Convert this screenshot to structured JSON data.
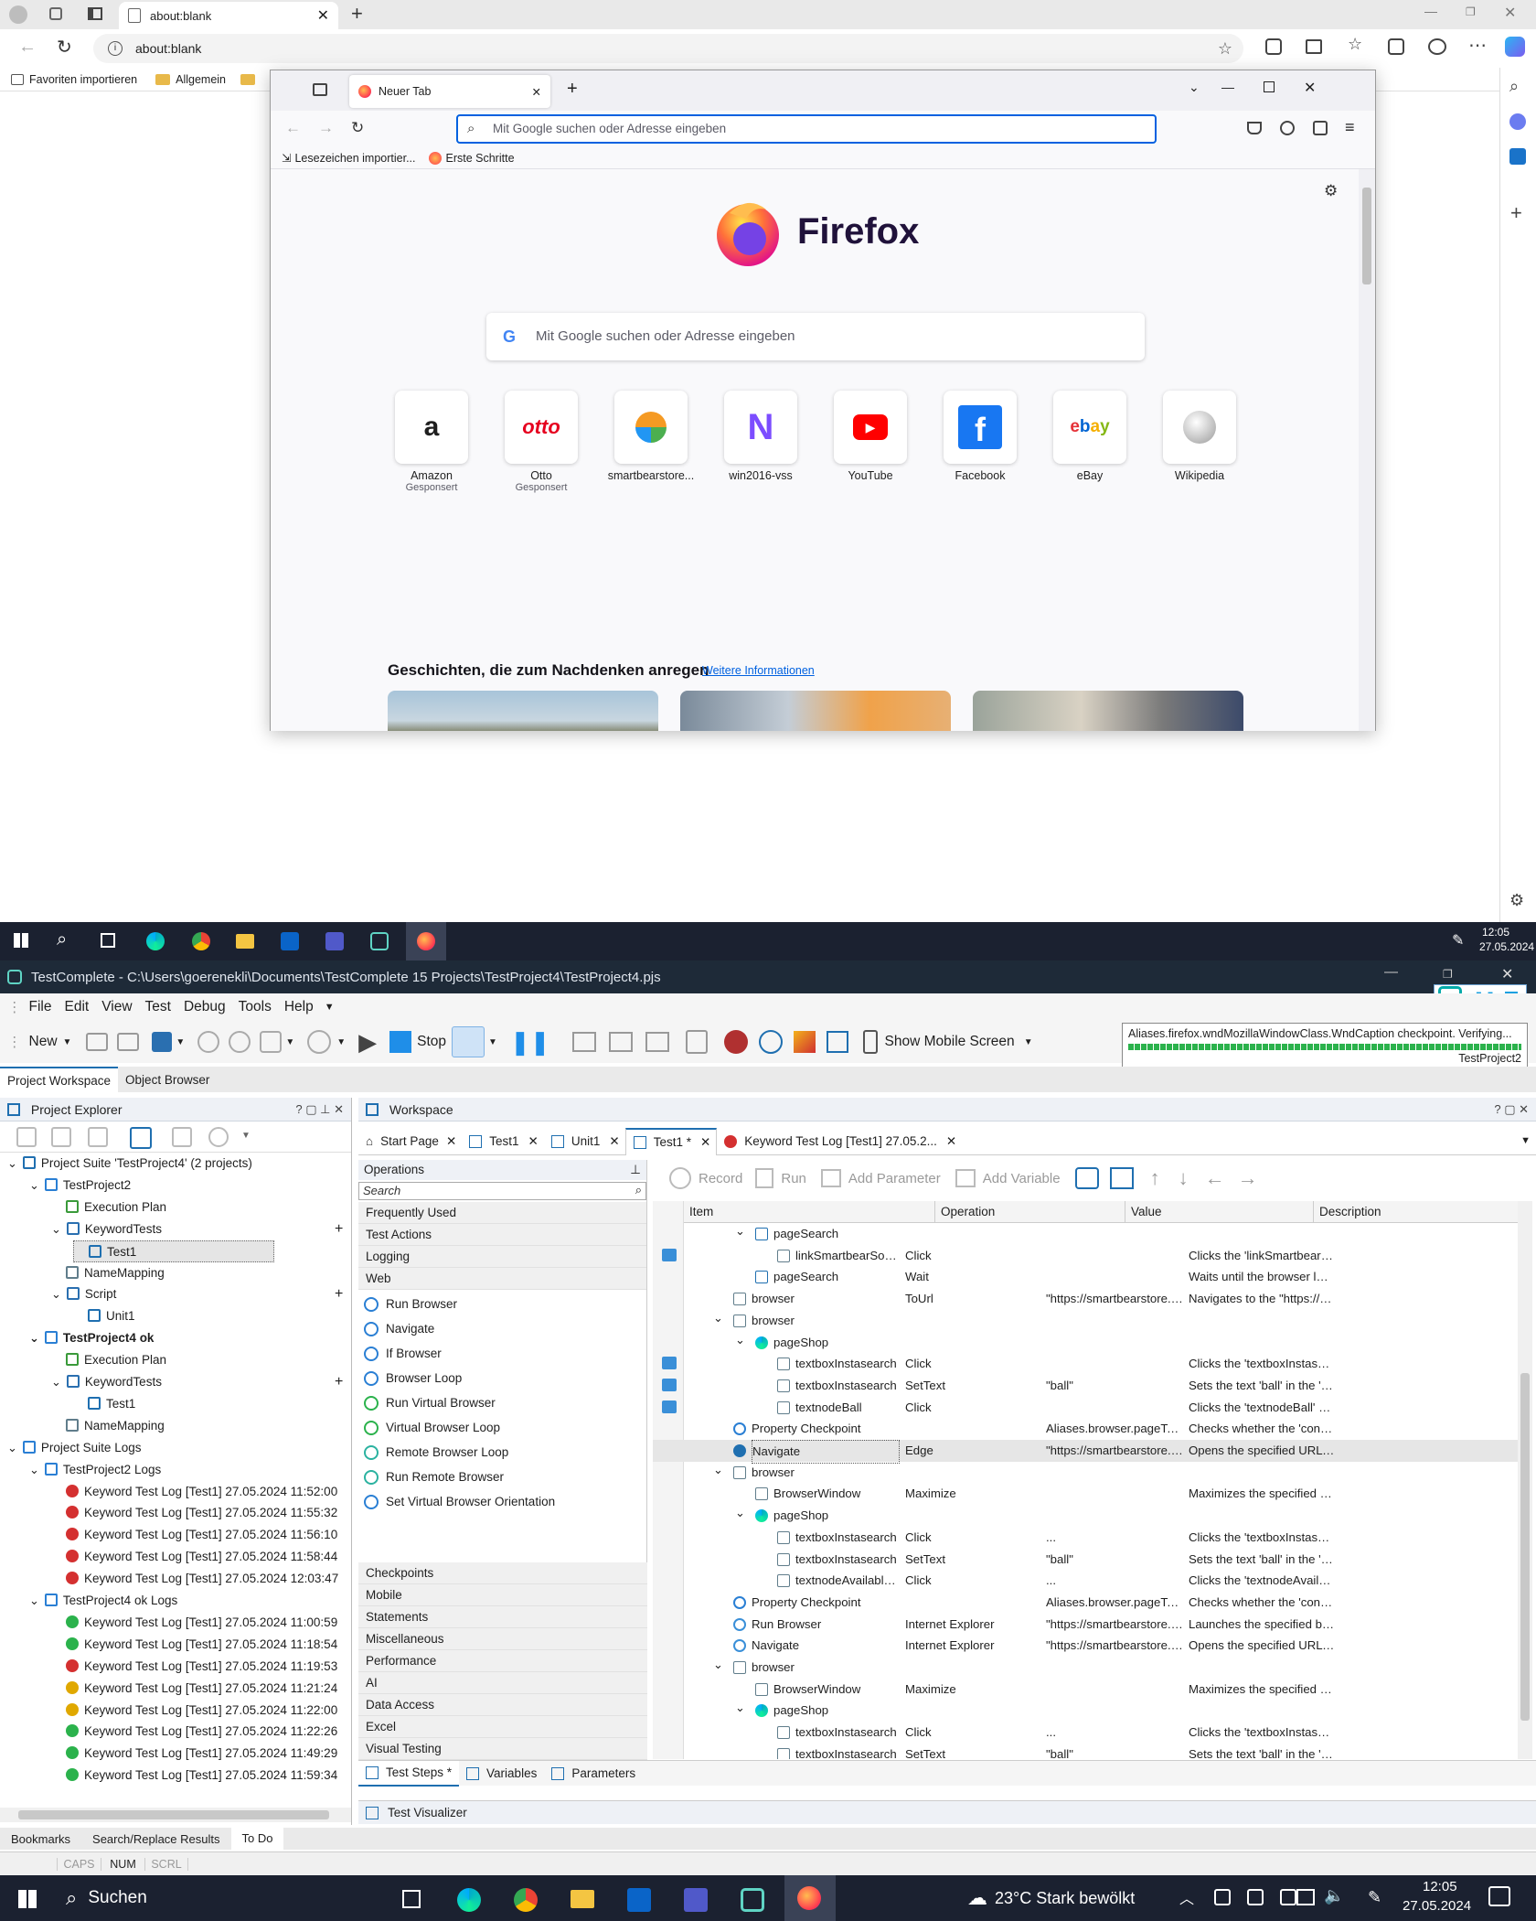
{
  "edge": {
    "tab_title": "about:blank",
    "url": "about:blank",
    "favorites": [
      "Favoriten importieren",
      "Allgemein"
    ]
  },
  "firefox": {
    "tab_title": "Neuer Tab",
    "url_placeholder": "Mit Google suchen oder Adresse eingeben",
    "bookmarks": [
      "Lesezeichen importier...",
      "Erste Schritte"
    ],
    "logo_text": "Firefox",
    "search_placeholder": "Mit Google suchen oder Adresse eingeben",
    "tiles": [
      {
        "label": "Amazon",
        "sub": "Gesponsert"
      },
      {
        "label": "Otto",
        "sub": "Gesponsert"
      },
      {
        "label": "smartbearstore...",
        "sub": ""
      },
      {
        "label": "win2016-vss",
        "sub": ""
      },
      {
        "label": "YouTube",
        "sub": ""
      },
      {
        "label": "Facebook",
        "sub": ""
      },
      {
        "label": "eBay",
        "sub": ""
      },
      {
        "label": "Wikipedia",
        "sub": ""
      }
    ],
    "stories_heading": "Geschichten, die zum Nachdenken anregen",
    "stories_link": "Weitere Informationen"
  },
  "taskbar_top": {
    "time": "12:05",
    "date": "27.05.2024"
  },
  "testcomplete": {
    "title": "TestComplete - C:\\Users\\goerenekli\\Documents\\TestComplete 15 Projects\\TestProject4\\TestProject4.pjs",
    "menu": [
      "File",
      "Edit",
      "View",
      "Test",
      "Debug",
      "Tools",
      "Help"
    ],
    "toolbar": {
      "new": "New",
      "stop": "Stop",
      "mobile": "Show Mobile Screen"
    },
    "checkpoint_status": "Aliases.firefox.wndMozillaWindowClass.WndCaption checkpoint. Verifying...",
    "checkpoint_project": "TestProject2",
    "left_tabs": [
      "Project Workspace",
      "Object Browser"
    ],
    "project_explorer": {
      "title": "Project Explorer",
      "rows": [
        "Project Suite 'TestProject4' (2 projects)",
        "TestProject2",
        "Execution Plan",
        "KeywordTests",
        "Test1",
        "NameMapping",
        "Script",
        "Unit1",
        "TestProject4 ok",
        "Execution Plan",
        "KeywordTests",
        "Test1",
        "NameMapping",
        "Project Suite Logs",
        "TestProject2 Logs",
        "Keyword Test Log [Test1] 27.05.2024 11:52:00",
        "Keyword Test Log [Test1] 27.05.2024 11:55:32",
        "Keyword Test Log [Test1] 27.05.2024 11:56:10",
        "Keyword Test Log [Test1] 27.05.2024 11:58:44",
        "Keyword Test Log [Test1] 27.05.2024 12:03:47",
        "TestProject4 ok Logs",
        "Keyword Test Log [Test1] 27.05.2024 11:00:59",
        "Keyword Test Log [Test1] 27.05.2024 11:18:54",
        "Keyword Test Log [Test1] 27.05.2024 11:19:53",
        "Keyword Test Log [Test1] 27.05.2024 11:21:24",
        "Keyword Test Log [Test1] 27.05.2024 11:22:00",
        "Keyword Test Log [Test1] 27.05.2024 11:22:26",
        "Keyword Test Log [Test1] 27.05.2024 11:49:29",
        "Keyword Test Log [Test1] 27.05.2024 11:59:34"
      ]
    },
    "workspace": {
      "title": "Workspace",
      "tabs": [
        "Start Page",
        "Test1",
        "Unit1",
        "Test1 *",
        "Keyword Test Log [Test1] 27.05.2..."
      ],
      "ops_title": "Operations",
      "search_placeholder": "Search",
      "ops_cats_top": [
        "Frequently Used",
        "Test Actions",
        "Logging",
        "Web"
      ],
      "ops_web": [
        "Run Browser",
        "Navigate",
        "If Browser",
        "Browser Loop",
        "Run Virtual Browser",
        "Virtual Browser Loop",
        "Remote Browser Loop",
        "Run Remote Browser",
        "Set Virtual Browser Orientation"
      ],
      "ops_cats_bottom": [
        "Checkpoints",
        "Mobile",
        "Statements",
        "Miscellaneous",
        "Performance",
        "AI",
        "Data Access",
        "Excel",
        "Visual Testing"
      ],
      "kt_toolbar": [
        "Record",
        "Run",
        "Add Parameter",
        "Add Variable"
      ],
      "columns": [
        "Item",
        "Operation",
        "Value",
        "Description"
      ],
      "rows": [
        [
          "pageSearch",
          "",
          "",
          ""
        ],
        [
          "linkSmartbearSoftware",
          "Click",
          "",
          "Clicks the 'linkSmartbearSoftwar..."
        ],
        [
          "pageSearch",
          "Wait",
          "",
          "Waits until the browser loads the..."
        ],
        [
          "browser",
          "ToUrl",
          "\"https://smartbearstore.smartbe...",
          "Navigates to the \"https://smartbe..."
        ],
        [
          "browser",
          "",
          "",
          ""
        ],
        [
          "pageShop",
          "",
          "",
          ""
        ],
        [
          "textboxInstasearch",
          "Click",
          "",
          "Clicks the 'textboxInstasearch' co..."
        ],
        [
          "textboxInstasearch",
          "SetText",
          "\"ball\"",
          "Sets the text 'ball' in the 'textboxI..."
        ],
        [
          "textnodeBall",
          "Click",
          "",
          "Clicks the 'textnodeBall' control."
        ],
        [
          "Property Checkpoint",
          "",
          "Aliases.browser.pageTorfabrikOff...",
          "Checks whether the 'contentText'..."
        ],
        [
          "Navigate",
          "Edge",
          "\"https://smartbearstore.smartbe...",
          "Opens the specified URL in a run..."
        ],
        [
          "browser",
          "",
          "",
          ""
        ],
        [
          "BrowserWindow",
          "Maximize",
          "",
          "Maximizes the specified Window ..."
        ],
        [
          "pageShop",
          "",
          "",
          ""
        ],
        [
          "textboxInstasearch",
          "Click",
          "...",
          "Clicks the 'textboxInstasearch' co..."
        ],
        [
          "textboxInstasearch",
          "SetText",
          "\"ball\"",
          "Sets the text 'ball' in the 'textboxI..."
        ],
        [
          "textnodeAvailableInDifferentC...",
          "Click",
          "...",
          "Clicks the 'textnodeAvailableInDiff..."
        ],
        [
          "Property Checkpoint",
          "",
          "Aliases.browser.pageTorfabrikOff...",
          "Checks whether the 'contentText'..."
        ],
        [
          "Run Browser",
          "Internet Explorer",
          "\"https://smartbearstore.smartbe...",
          "Launches the specified browser a..."
        ],
        [
          "Navigate",
          "Internet Explorer",
          "\"https://smartbearstore.smartbe...",
          "Opens the specified URL in a run..."
        ],
        [
          "browser",
          "",
          "",
          ""
        ],
        [
          "BrowserWindow",
          "Maximize",
          "",
          "Maximizes the specified Window ..."
        ],
        [
          "pageShop",
          "",
          "",
          ""
        ],
        [
          "textboxInstasearch",
          "Click",
          "...",
          "Clicks the 'textboxInstasearch' co..."
        ],
        [
          "textboxInstasearch",
          "SetText",
          "\"ball\"",
          "Sets the text 'ball' in the 'textboxI..."
        ]
      ],
      "bottom_tabs": [
        "Test Steps *",
        "Variables",
        "Parameters"
      ],
      "visualizer": "Test Visualizer"
    },
    "bottom_tabs": [
      "Bookmarks",
      "Search/Replace Results",
      "To Do"
    ],
    "status": [
      "CAPS",
      "NUM",
      "SCRL"
    ]
  },
  "taskbar": {
    "search": "Suchen",
    "weather": "23°C  Stark bewölkt",
    "time": "12:05",
    "date": "27.05.2024"
  }
}
